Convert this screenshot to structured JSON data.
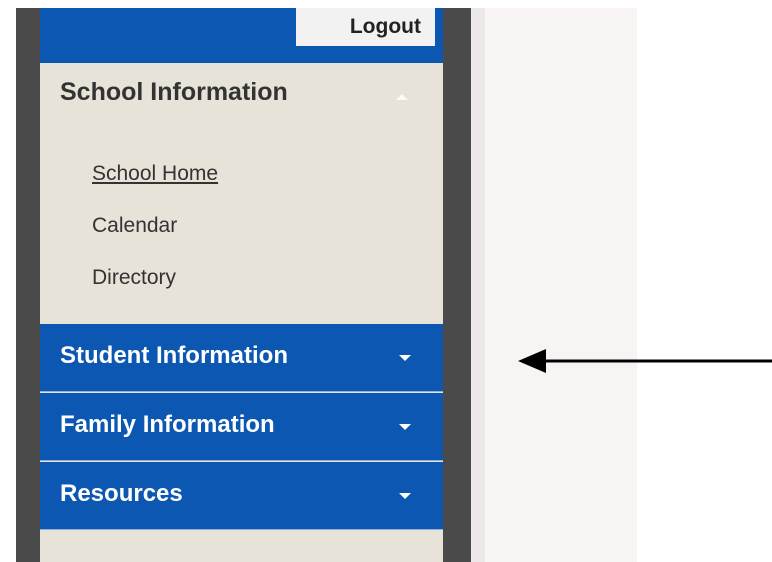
{
  "header": {
    "logout_label": "Logout"
  },
  "school_info": {
    "title": "School Information",
    "links": [
      "School Home",
      "Calendar",
      "Directory"
    ]
  },
  "nav": [
    {
      "label": "Student Information"
    },
    {
      "label": "Family Information"
    },
    {
      "label": "Resources"
    }
  ],
  "colors": {
    "brand_blue": "#0b57b1",
    "sidebar_bg": "#e7e3d8",
    "frame": "#4a4a4a"
  },
  "icons": {
    "section_toggle": "chevron-up-icon",
    "nav_toggle": "chevron-down-icon",
    "annotation": "arrow-left-icon"
  }
}
